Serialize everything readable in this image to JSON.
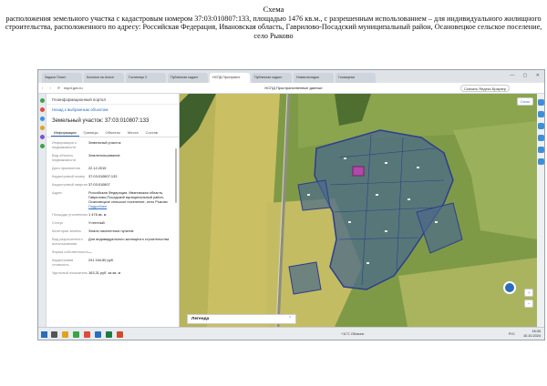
{
  "caption": {
    "title": "Схема",
    "body": "расположения земельного участка с кадастровым номером 37:03:010807:133, площадью 1476 кв.м., с разрешенным использованием – для индивидуального жилищного строительства, расположенного по адресу: Российская Федерация, Ивановская область, Гаврилово-Посадский муниципальный район, Осановецкое сельское поселение, село Рыково"
  },
  "browser": {
    "tabs": [
      "Задачи Пласт",
      "Колонка на Алисе",
      "Гостинице 2",
      "Публичная кадаст",
      "НСПД Пространст",
      "Публичная кадаст",
      "Новая вкладка",
      "Госзакупки"
    ],
    "active_tab": 4,
    "url": "nspd.gov.ru",
    "page_title": "НСПД Пространственные данные",
    "yandex_button": "Скачать Яндекс.Браузер"
  },
  "panel": {
    "header": "Геоинформационный портал",
    "back_link": "Назад к выбранным объектам",
    "object_title": "Земельный участок: 37:03:010807:133",
    "tabs": [
      "Информация",
      "Границы",
      "Объекты",
      "Места",
      "Состав"
    ],
    "active_tab": 0,
    "rows": [
      {
        "k": "Информация о недвижимости",
        "v": "Земельный участок"
      },
      {
        "k": "Вид объекта недвижимости",
        "v": "Землепользование"
      },
      {
        "k": "Дата присвоения",
        "v": "22.12.2015"
      },
      {
        "k": "Кадастровый номер",
        "v": "37:03:010807:133"
      },
      {
        "k": "Кадастровый квартал",
        "v": "37:03:010807"
      },
      {
        "k": "Адрес",
        "v": "Российская Федерация, Ивановская область, Гаврилово-Посадский муниципальный район, Осановецкое сельское поселение, село Рыково",
        "link": "Подробнее"
      },
      {
        "k": "Площадь уточненная",
        "v": "1 476 кв. м"
      },
      {
        "k": "Статус",
        "v": "Учтенный"
      },
      {
        "k": "Категория земель",
        "v": "Земли населенных пунктов"
      },
      {
        "k": "Вид разрешенного использования",
        "v": "Для индивидуального жилищного строительства"
      },
      {
        "k": "Форма собственности",
        "v": "—"
      },
      {
        "k": "Кадастровая стоимость",
        "v": "241 044,80 руб."
      },
      {
        "k": "Удельный показатель",
        "v": "163,31 руб. за кв. м"
      }
    ]
  },
  "map": {
    "legend": "Легенда",
    "layers_button": "Слои",
    "zoom_in": "+",
    "zoom_out": "−"
  },
  "taskbar": {
    "weather": "+11°C Облачно",
    "tray": "РУС",
    "time": "16:33",
    "date": "10.10.2024"
  },
  "colors": {
    "accent": "#2a6ebb",
    "parcel_border": "#2c3f8c",
    "parcel_fill": "#4a6a8a",
    "selected_parcel": "#b04aa6",
    "field_light": "#c9c169",
    "field_green": "#6f8f3c",
    "forest": "#3f5f2c"
  }
}
